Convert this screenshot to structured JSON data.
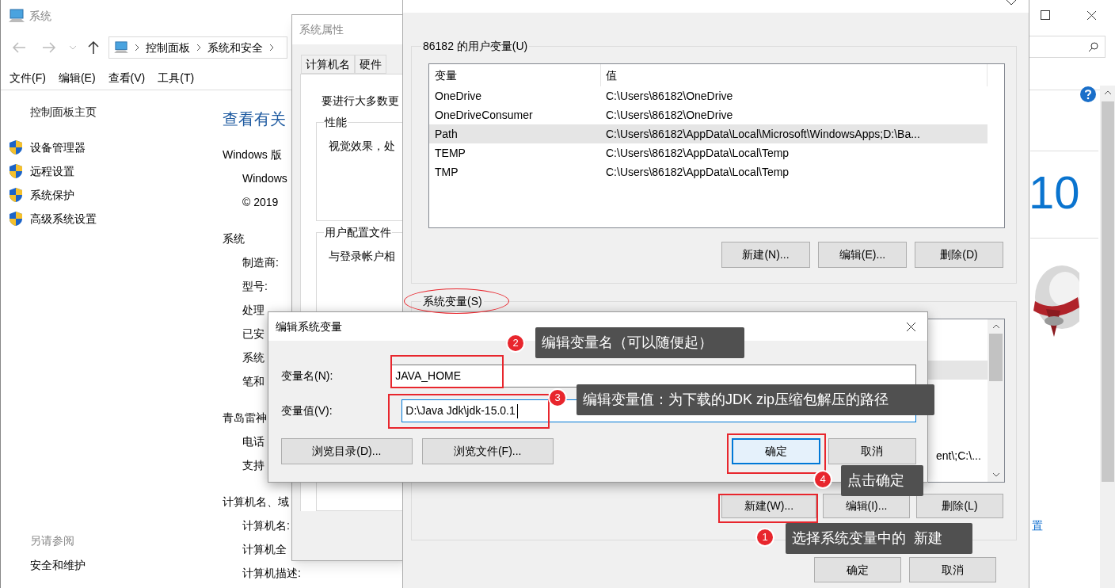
{
  "system_window": {
    "title": "系统",
    "breadcrumb": [
      "控制面板",
      "系统和安全"
    ],
    "menu": [
      "文件(F)",
      "编辑(E)",
      "查看(V)",
      "工具(T)"
    ],
    "sidebar": {
      "home": "控制面板主页",
      "links": [
        "设备管理器",
        "远程设置",
        "系统保护",
        "高级系统设置"
      ],
      "see_also": "另请参阅",
      "see_also_links": [
        "安全和维护"
      ]
    },
    "content": [
      {
        "kind": "title",
        "text": "查看有关"
      },
      {
        "kind": "heading",
        "text": "Windows 版"
      },
      {
        "kind": "field",
        "text": "Windows"
      },
      {
        "kind": "field",
        "text": "© 2019"
      },
      {
        "kind": "section",
        "text": "系统"
      },
      {
        "kind": "field",
        "text": "制造商:"
      },
      {
        "kind": "field",
        "text": "型号:"
      },
      {
        "kind": "field",
        "text": "处理"
      },
      {
        "kind": "field",
        "text": "已安"
      },
      {
        "kind": "field",
        "text": "系统"
      },
      {
        "kind": "field",
        "text": "笔和"
      },
      {
        "kind": "section",
        "text": "青岛雷神"
      },
      {
        "kind": "field",
        "text": "电话"
      },
      {
        "kind": "field",
        "text": "支持"
      },
      {
        "kind": "section",
        "text": "计算机名、域"
      },
      {
        "kind": "field",
        "text": "计算机名:"
      },
      {
        "kind": "field",
        "text": "计算机全"
      },
      {
        "kind": "field",
        "text": "计算机描述:"
      }
    ],
    "edition_mark": "10",
    "side_link": "置"
  },
  "system_properties": {
    "title": "系统属性",
    "tabs": [
      {
        "label": "计算机名",
        "selected": false
      },
      {
        "label": "硬件",
        "selected": false
      }
    ],
    "intro": "要进行大多数更",
    "groups": [
      {
        "label": "性能",
        "text": "视觉效果，处"
      },
      {
        "label": "用户配置文件",
        "text": "与登录帐户相"
      }
    ]
  },
  "environment_variables": {
    "user_group": {
      "label": "86182 的用户变量(U)",
      "columns": [
        "变量",
        "值"
      ],
      "rows": [
        {
          "name": "OneDrive",
          "value": "C:\\Users\\86182\\OneDrive",
          "selected": false
        },
        {
          "name": "OneDriveConsumer",
          "value": "C:\\Users\\86182\\OneDrive",
          "selected": false
        },
        {
          "name": "Path",
          "value": "C:\\Users\\86182\\AppData\\Local\\Microsoft\\WindowsApps;D:\\Ba...",
          "selected": true
        },
        {
          "name": "TEMP",
          "value": "C:\\Users\\86182\\AppData\\Local\\Temp",
          "selected": false
        },
        {
          "name": "TMP",
          "value": "C:\\Users\\86182\\AppData\\Local\\Temp",
          "selected": false
        }
      ],
      "buttons": [
        "新建(N)...",
        "编辑(E)...",
        "删除(D)"
      ]
    },
    "system_group": {
      "label": "系统变量(S)",
      "visible_cell": "ent\\;C:\\...",
      "buttons": [
        "新建(W)...",
        "编辑(I)...",
        "删除(L)"
      ]
    },
    "buttons": [
      "确定",
      "取消"
    ]
  },
  "edit_dialog": {
    "title": "编辑系统变量",
    "fields": [
      {
        "label": "变量名(N):",
        "value": "JAVA_HOME",
        "focused": false
      },
      {
        "label": "变量值(V):",
        "value": "D:\\Java Jdk\\jdk-15.0.1",
        "focused": true
      }
    ],
    "buttons": [
      {
        "label": "浏览目录(D)...",
        "default": false
      },
      {
        "label": "浏览文件(F)...",
        "default": false
      },
      {
        "label": "确定",
        "default": true
      },
      {
        "label": "取消",
        "default": false
      }
    ]
  },
  "annotations": [
    {
      "number": "1",
      "text": "选择系统变量中的  新建"
    },
    {
      "number": "2",
      "text": "编辑变量名（可以随便起）"
    },
    {
      "number": "3",
      "text": "编辑变量值：为下载的JDK zip压缩包解压的路径"
    },
    {
      "number": "4",
      "text": "点击确定"
    }
  ]
}
